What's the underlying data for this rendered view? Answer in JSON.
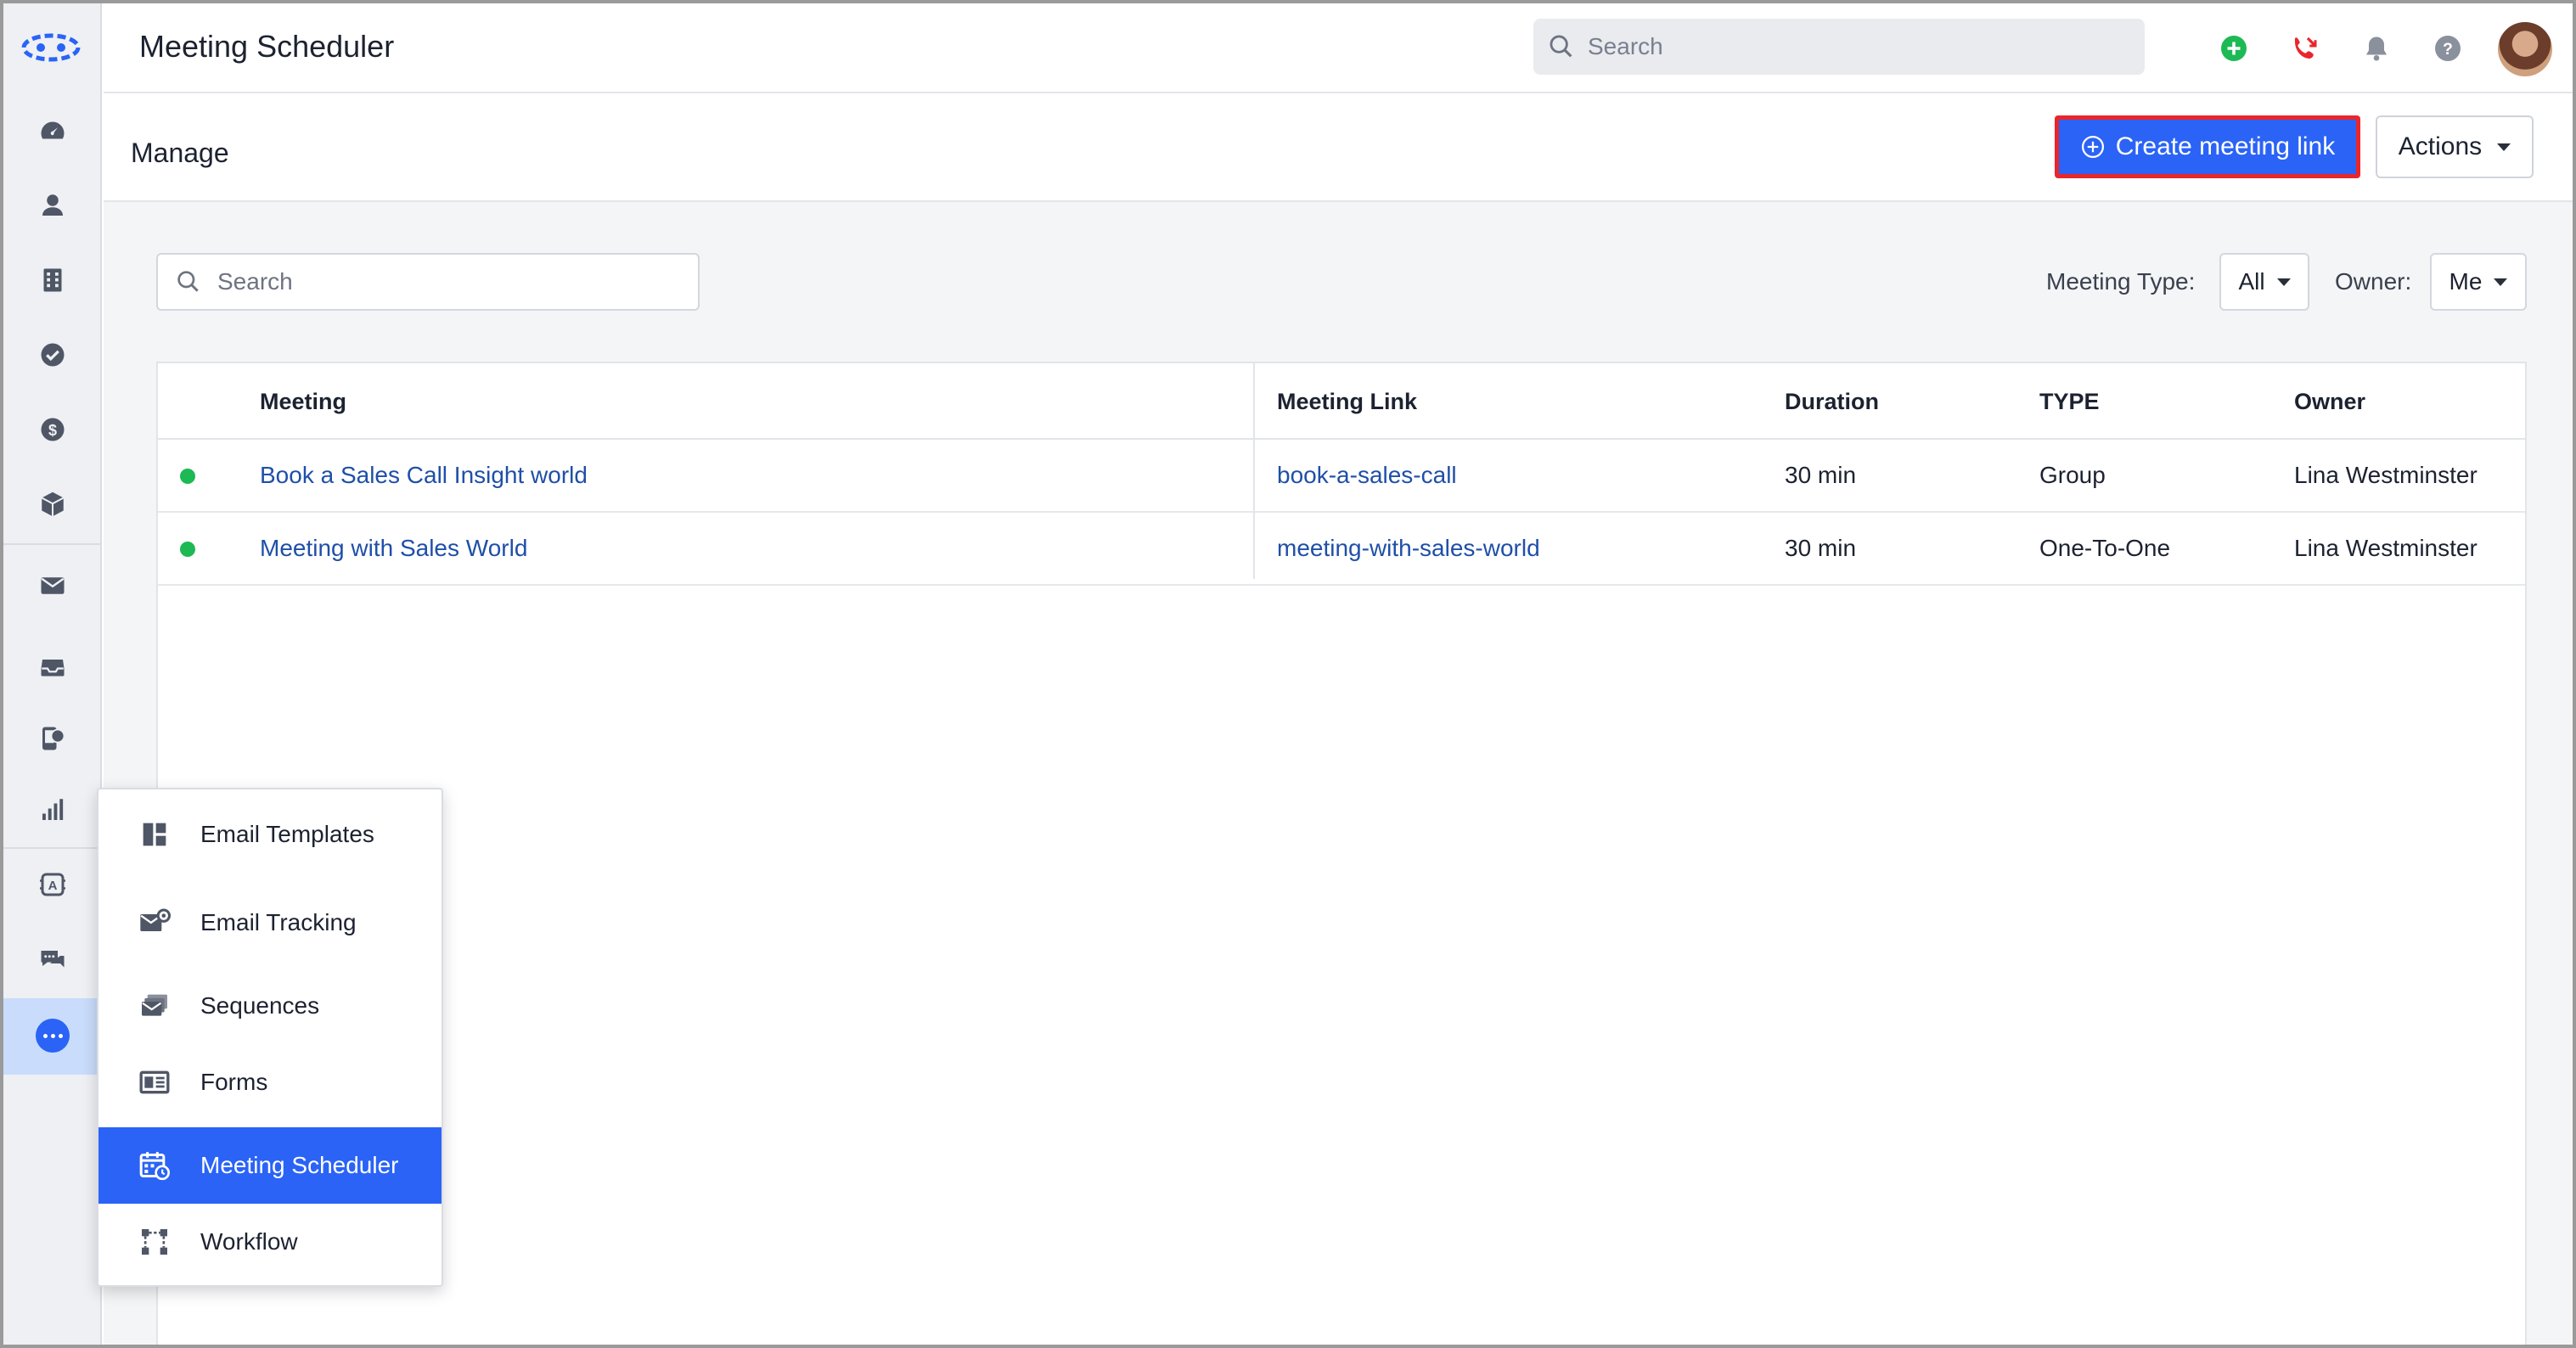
{
  "app": {
    "title": "Meeting Scheduler"
  },
  "topbar": {
    "search_placeholder": "Search",
    "icons": [
      "add-circle-icon",
      "phone-missed-icon",
      "bell-icon",
      "help-icon",
      "avatar"
    ],
    "colors": {
      "add": "#1db954",
      "phone": "#e8262b",
      "muted": "#8a909c"
    }
  },
  "rail": {
    "icons": [
      "logo-icon",
      "dashboard-icon",
      "contact-icon",
      "company-icon",
      "task-icon",
      "deal-icon",
      "product-icon",
      "mail-icon",
      "inbox-icon",
      "phone-chat-icon",
      "reports-icon",
      "ai-assistant-icon",
      "chat-icon",
      "more-icon"
    ]
  },
  "manage": {
    "title": "Manage",
    "create_label": "Create meeting link",
    "actions_label": "Actions"
  },
  "filters": {
    "search_placeholder": "Search",
    "meeting_type_label": "Meeting Type:",
    "meeting_type_value": "All",
    "owner_label": "Owner:",
    "owner_value": "Me"
  },
  "table": {
    "headers": {
      "meeting": "Meeting",
      "link": "Meeting Link",
      "duration": "Duration",
      "type": "TYPE",
      "owner": "Owner"
    },
    "rows": [
      {
        "meeting": "Book a Sales Call Insight world",
        "link": "book-a-sales-call",
        "duration": "30 min",
        "type": "Group",
        "owner": "Lina Westminster"
      },
      {
        "meeting": "Meeting with Sales World",
        "link": "meeting-with-sales-world",
        "duration": "30 min",
        "type": "One-To-One",
        "owner": "Lina Westminster"
      }
    ]
  },
  "menu": {
    "items": [
      {
        "label": "Email Templates",
        "icon": "template-icon"
      },
      {
        "label": "Email Tracking",
        "icon": "mail-tracking-icon"
      },
      {
        "label": "Sequences",
        "icon": "sequences-icon"
      },
      {
        "label": "Forms",
        "icon": "form-icon"
      },
      {
        "label": "Meeting Scheduler",
        "icon": "calendar-clock-icon",
        "active": true
      },
      {
        "label": "Workflow",
        "icon": "workflow-icon"
      }
    ]
  },
  "colors": {
    "accent": "#2a63f6",
    "highlight_border": "#e8262b",
    "status_active": "#1db954",
    "link": "#1f4fa8"
  }
}
